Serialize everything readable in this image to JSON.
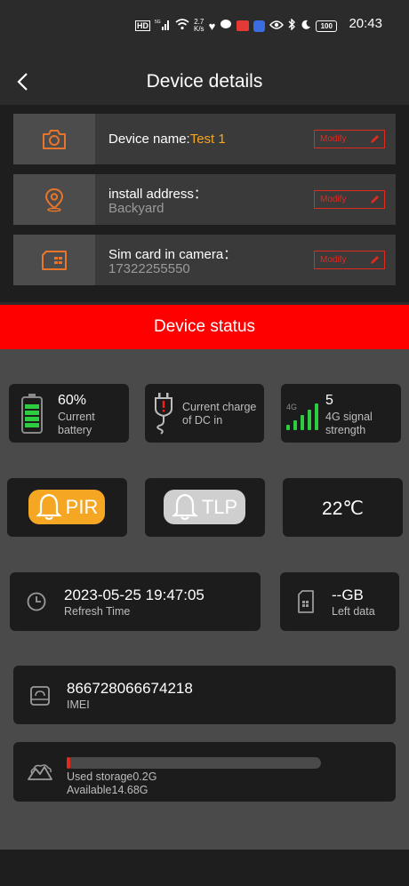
{
  "status_bar": {
    "net_type": "5G",
    "speed": "2.7",
    "speed_unit": "K/s",
    "battery": "100",
    "time": "20:43"
  },
  "header": {
    "title": "Device details"
  },
  "info": {
    "device_name_label": "Device name:",
    "device_name_value": "Test 1",
    "address_label": "install address：",
    "address_value": "Backyard",
    "sim_label": "Sim card in camera：",
    "sim_value": "17322255550",
    "modify_label": "Modify"
  },
  "device_status": {
    "title": "Device status",
    "battery_pct": "60%",
    "battery_label": "Current battery",
    "battery_level": 0.6,
    "dc_label": "Current charge of DC in",
    "signal_type": "4G",
    "signal_value": "5",
    "signal_label": "4G signal strength",
    "pir_label": "PIR",
    "tlp_label": "TLP",
    "temperature": "22℃",
    "refresh_time": "2023-05-25 19:47:05",
    "refresh_label": "Refresh Time",
    "left_data": "--GB",
    "left_data_label": "Left data",
    "imei": "866728066674218",
    "imei_label": "IMEI",
    "used_storage": "Used storage0.2G",
    "available_storage": "Available14.68G",
    "storage_fraction": 0.0134
  },
  "colors": {
    "accent_orange": "#f5a623",
    "alert_red": "#ff0000",
    "signal_green": "#2ecc40"
  }
}
